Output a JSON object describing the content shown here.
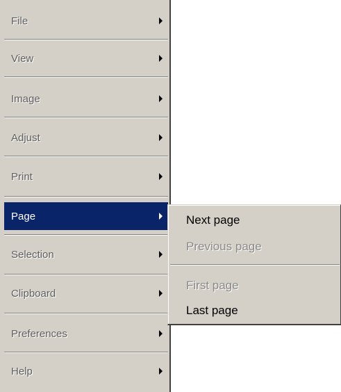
{
  "menu": {
    "items": [
      {
        "label": "File"
      },
      {
        "label": "View"
      },
      {
        "label": "Image"
      },
      {
        "label": "Adjust"
      },
      {
        "label": "Print"
      },
      {
        "label": "Page"
      },
      {
        "label": "Selection"
      },
      {
        "label": "Clipboard"
      },
      {
        "label": "Preferences"
      },
      {
        "label": "Help"
      }
    ],
    "selected": "Page"
  },
  "submenu": {
    "items": [
      {
        "label": "Next page",
        "enabled": true
      },
      {
        "label": "Previous page",
        "enabled": false
      },
      {
        "label": "First page",
        "enabled": false
      },
      {
        "label": "Last page",
        "enabled": true
      }
    ]
  },
  "colors": {
    "menu_background": "#d4d0c8",
    "highlight": "#0a246a",
    "highlight_text": "#ffffff",
    "disabled_text": "#8a8a8a"
  }
}
